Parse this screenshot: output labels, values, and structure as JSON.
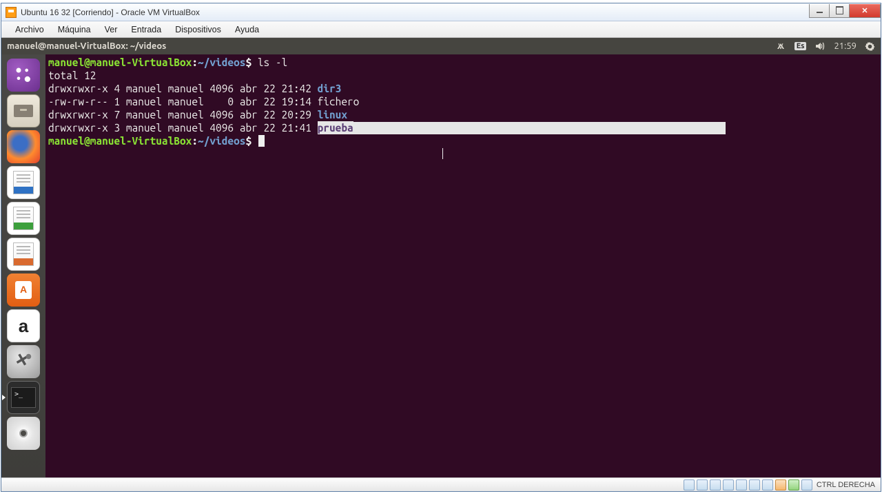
{
  "virtualbox": {
    "title": "Ubuntu 16 32 [Corriendo] - Oracle VM VirtualBox",
    "menu": {
      "archivo": "Archivo",
      "maquina": "Máquina",
      "ver": "Ver",
      "entrada": "Entrada",
      "dispositivos": "Dispositivos",
      "ayuda": "Ayuda"
    },
    "statusbar": {
      "hostkey": "CTRL DERECHA"
    }
  },
  "ubuntu_topbar": {
    "title": "manuel@manuel-VirtualBox: ~/videos",
    "keyboard": "Es",
    "time": "21:59"
  },
  "launcher": {
    "items": [
      {
        "name": "dash",
        "label": "Dash"
      },
      {
        "name": "files",
        "label": "Files"
      },
      {
        "name": "firefox",
        "label": "Firefox"
      },
      {
        "name": "writer",
        "label": "LibreOffice Writer"
      },
      {
        "name": "calc",
        "label": "LibreOffice Calc"
      },
      {
        "name": "impress",
        "label": "LibreOffice Impress"
      },
      {
        "name": "software",
        "label": "Ubuntu Software"
      },
      {
        "name": "amazon",
        "label": "Amazon"
      },
      {
        "name": "settings",
        "label": "System Settings"
      },
      {
        "name": "terminal",
        "label": "Terminal"
      },
      {
        "name": "disc",
        "label": "Disc"
      }
    ]
  },
  "terminal": {
    "prompt_user": "manuel@manuel-VirtualBox",
    "prompt_path": "~/videos",
    "command": "ls -l",
    "output": {
      "total": "total 12",
      "rows": [
        {
          "perm": "drwxrwxr-x",
          "links": "4",
          "owner": "manuel",
          "group": "manuel",
          "size": "4096",
          "month": "abr",
          "day": "22",
          "time": "21:42",
          "name": "dir3",
          "type": "dir"
        },
        {
          "perm": "-rw-rw-r--",
          "links": "1",
          "owner": "manuel",
          "group": "manuel",
          "size": "   0",
          "month": "abr",
          "day": "22",
          "time": "19:14",
          "name": "fichero",
          "type": "file"
        },
        {
          "perm": "drwxrwxr-x",
          "links": "7",
          "owner": "manuel",
          "group": "manuel",
          "size": "4096",
          "month": "abr",
          "day": "22",
          "time": "20:29",
          "name": "linux",
          "type": "dir"
        },
        {
          "perm": "drwxrwxr-x",
          "links": "3",
          "owner": "manuel",
          "group": "manuel",
          "size": "4096",
          "month": "abr",
          "day": "22",
          "time": "21:41",
          "name": "prueba",
          "type": "dir",
          "selected": true
        }
      ]
    }
  }
}
